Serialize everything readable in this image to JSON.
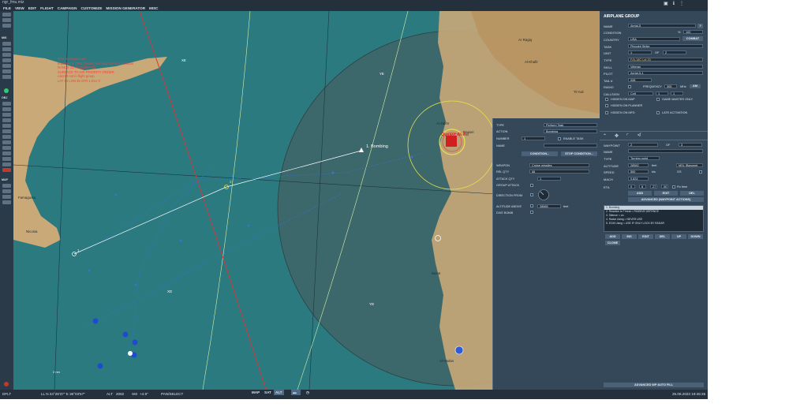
{
  "window": {
    "title": "ngr_fmu.miz"
  },
  "menu": [
    "FILE",
    "VIEW",
    "EDIT",
    "FLIGHT",
    "CAMPAIGN",
    "CUSTOMIZE",
    "MISSION GENERATOR",
    "MISC"
  ],
  "toolbar": {
    "mis_label": "MIS",
    "obj_label": "OBJ",
    "map_label": "MAP"
  },
  "map": {
    "colors": {
      "sea": "#2a7a80",
      "land": "#c9a978",
      "route": "#d9f0a8",
      "threat": "#cf3b3b"
    },
    "labels": {
      "bombing": "1. Bombing",
      "city_main": "Qusayr Al-Ad",
      "city_2": "Al Zakhr",
      "city_3": "Al-Hadas",
      "city_4": "Famagusta",
      "city_5": "Rassel",
      "city_6": "Ar Ragiq",
      "city_7": "Al-Khafir",
      "city_8": "Tir Kal",
      "city_9": "Basat",
      "city_10": "Nicosia",
      "grid_yd": "YD",
      "grid_ye": "YE",
      "grid_xe": "XE",
      "grid_xd": "XD",
      "wp1": "1",
      "wp2": "2",
      "scale": "2 nm"
    },
    "red_info": [
      "DRS not supported",
      "Imported to DRS (Radar) unit may not be in mission",
      "RANGE 12 nm   SURFACE",
      "SURFACE TO AIR PRIORITY ORDER",
      "Aircraft not in flight group",
      "LAT 34 LON 35 STR 1 ELV 0"
    ]
  },
  "statusbar": {
    "mode": "DFLT",
    "coords": "LL  N 34°28'37\"   E 36°03'57\"",
    "alt_label": "ALT",
    "alt_value": "2082",
    "sm_label": "SM",
    "sm_value": "+4.9\"",
    "pan": "PAN/SELECT",
    "btn_map": "MAP",
    "btn_sat": "SAT",
    "btn_alt": "ALT",
    "datetime": "25.06.2023 19:45:35"
  },
  "task_dialog": {
    "type_label": "TYPE",
    "type_value": "Perform Task",
    "action_label": "ACTION",
    "action_value": "Bombing",
    "number_label": "NUMBER",
    "number_value": "1",
    "enable_task": "ENABLE TASK",
    "name_label": "NAME",
    "condition_btn": "CONDITION...",
    "stop_condition_btn": "STOP CONDITION...",
    "weapon_label": "WEAPON",
    "weapon_value": "Cruise missiles",
    "release_qty_label": "REL QTY",
    "release_qty_value": "All",
    "attack_qty_label": "ATTACK QTY",
    "attack_qty_value": "1",
    "group_attack_label": "GROUP ATTACK",
    "direction_label": "DIRECTION FROM",
    "altitude_above_label": "ALTITUDE ABOVE",
    "altitude_above_value": "28565",
    "altitude_unit": "feet",
    "dive_bomb_label": "DIVE BOMB"
  },
  "panel": {
    "title": "AIRPLANE GROUP",
    "help": "?",
    "name_label": "NAME",
    "name_value": "Aerial-5",
    "condition_label": "CONDITION",
    "condition_pct": "%",
    "condition_value": "100",
    "country_label": "COUNTRY",
    "country_value": "USA",
    "combat_btn": "COMBAT",
    "task_label": "TASK",
    "task_value": "Pinpoint Strike",
    "unit_label": "UNIT",
    "unit_value": "1",
    "unit_of": "OF",
    "unit_total": "2",
    "type_label": "TYPE",
    "type_value": "F/A-18C Lot 20",
    "skill_label": "SKILL",
    "skill_value": "Veteran",
    "pilot_label": "PILOT",
    "pilot_value": "Aerial-5-1",
    "tail_label": "TAIL #",
    "tail_value": "008",
    "radio_label": "RADIO",
    "frequency_label": "FREQUENCY",
    "frequency_value": "305",
    "mhz": "MHz",
    "am": "AM",
    "callsign_label": "CALLSIGN",
    "callsign_value": "Colt",
    "callsign_n1": "1",
    "callsign_n2": "1",
    "hidden_map": "HIDDEN ON MAP",
    "game_master": "GAME MASTER ONLY",
    "hidden_planner": "HIDDEN ON PLANNER",
    "hidden_mfd": "HIDDEN ON MFD",
    "late_activation": "LATE ACTIVATION",
    "waypoint_label": "WAYPOINT",
    "waypoint_value": "2",
    "waypoint_of": "OF",
    "waypoint_total": "3",
    "wp_name_label": "NAME",
    "wp_type_label": "TYPE",
    "wp_type_value": "Turning point",
    "altitude_label": "ALTITUDE",
    "altitude_value": "28562",
    "altitude_unit": "feet",
    "altitude_ref": "MSL (Baromet",
    "speed_label": "SPEED",
    "speed_value": "500",
    "speed_unit": "kts",
    "gs": "GS",
    "mach_label": "MACH",
    "mach_value": "0.824",
    "eta_label": "ETA",
    "eta_d": "0",
    "eta_h": "8",
    "eta_m": "27",
    "eta_s": "00",
    "eta_fix": "Fix time",
    "add_btn": "ADD",
    "edit_btn": "EDIT",
    "del_btn": "DEL",
    "advanced_btn": "ADVANCED (WAYPOINT ACTIONS)",
    "actions": [
      "1. Bombing",
      "2. Reaction to Threat = PASSIVE DEFENCE",
      "3. Silence = on",
      "4. Radar Using = NEVER USE",
      "5. ECM Using = USE IF ONLY LOCK BY RADAR"
    ],
    "action_btns": [
      "ADD",
      "INS",
      "EDIT",
      "DEL",
      "UP",
      "DOWN"
    ],
    "clone_btn": "CLONE",
    "auto_fill_btn": "ADVANCED WP AUTO FILL"
  }
}
